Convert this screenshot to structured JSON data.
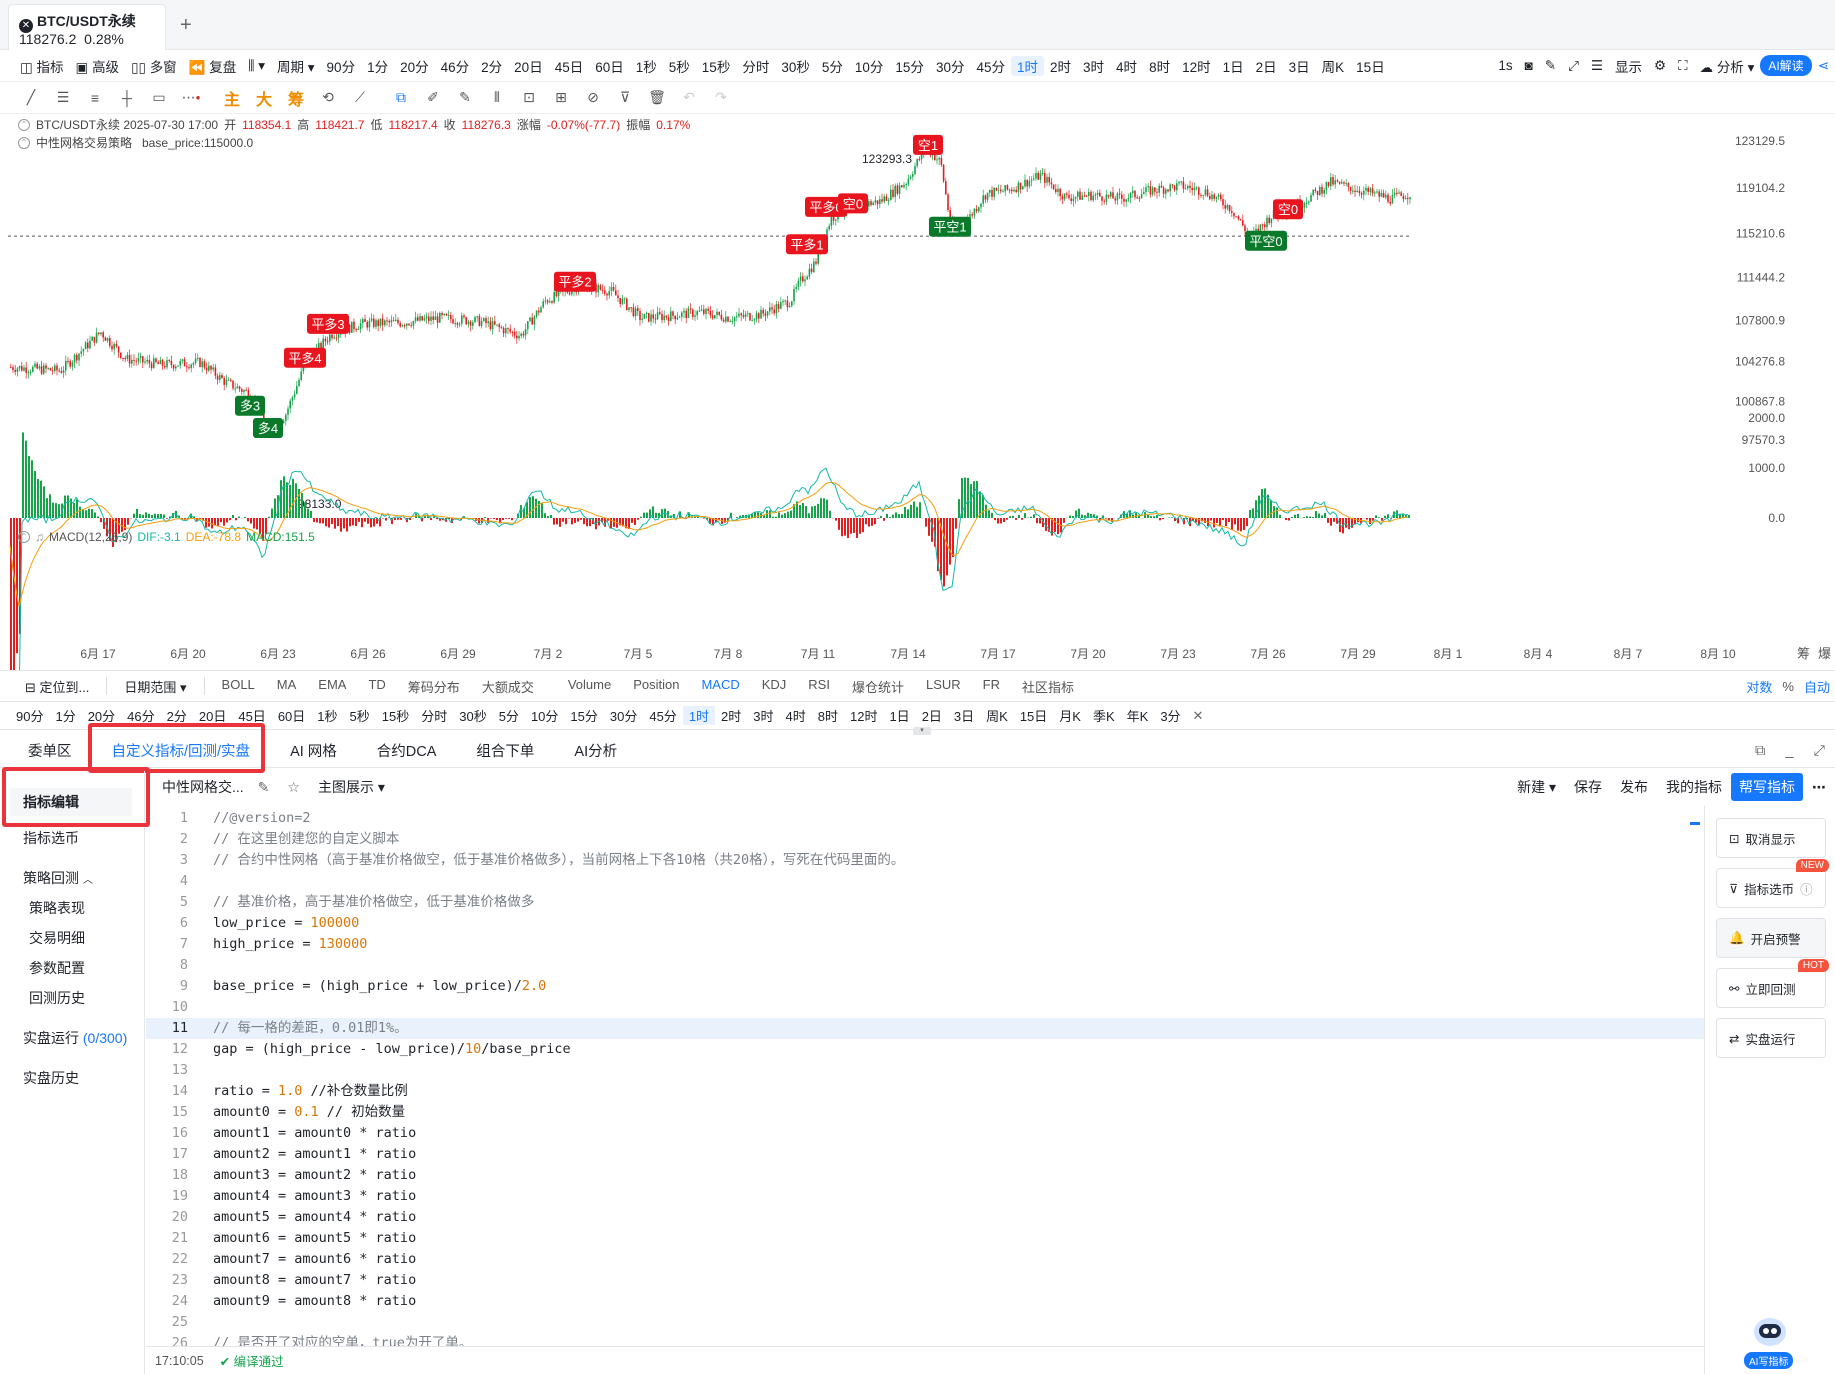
{
  "tab": {
    "symbol": "BTC/USDT永续",
    "price": "118276.2",
    "change": "0.28%",
    "add": "+"
  },
  "toolbar1": {
    "left": [
      "指标",
      "高级",
      "多窗",
      "复盘",
      "周期"
    ],
    "periods": [
      "90分",
      "1分",
      "20分",
      "46分",
      "2分",
      "20日",
      "45日",
      "60日",
      "1秒",
      "5秒",
      "15秒",
      "分时",
      "30秒",
      "5分",
      "10分",
      "15分",
      "30分",
      "45分",
      "1时",
      "2时",
      "3时",
      "4时",
      "8时",
      "12时",
      "1日",
      "2日",
      "3日",
      "周K",
      "15日"
    ],
    "active": "1时",
    "right": [
      "1s",
      "显示",
      "分析",
      "AI解读"
    ]
  },
  "toolbar2": {
    "text_tools": [
      "主",
      "大",
      "筹"
    ]
  },
  "chart_info": {
    "line1_prefix": "BTC/USDT永续  2025-07-30 17:00",
    "open_label": "开",
    "open": "118354.1",
    "high_label": "高",
    "high": "118421.7",
    "low_label": "低",
    "low": "118217.4",
    "close_label": "收",
    "close": "118276.3",
    "chg_label": "涨幅",
    "chg": "-0.07%(-77.7)",
    "amp_label": "振幅",
    "amp": "0.17%",
    "line2": "中性网格交易策略   base_price:115000.0"
  },
  "chart_data": {
    "type": "line",
    "price_axis": [
      "123129.5",
      "119104.2",
      "115210.6",
      "111444.2",
      "107800.9",
      "104276.8",
      "100867.8",
      "97570.3"
    ],
    "high_label": "123293.3",
    "low_label": "98133.0",
    "base_price": 115000.0,
    "x_axis": [
      "6月 17",
      "6月 20",
      "6月 23",
      "6月 26",
      "6月 29",
      "7月 2",
      "7月 5",
      "7月 8",
      "7月 11",
      "7月 14",
      "7月 17",
      "7月 20",
      "7月 23",
      "7月 26",
      "7月 29",
      "8月 1",
      "8月 4",
      "8月 7",
      "8月 10"
    ],
    "signals": [
      {
        "label": "多3",
        "type": "long",
        "price": 100500
      },
      {
        "label": "多4",
        "type": "long",
        "price": 98600
      },
      {
        "label": "平多4",
        "type": "close",
        "price": 104600
      },
      {
        "label": "平多3",
        "type": "close",
        "price": 107500
      },
      {
        "label": "平多2",
        "type": "close",
        "price": 111100
      },
      {
        "label": "平多1",
        "type": "close",
        "price": 114300
      },
      {
        "label": "平多0",
        "type": "close",
        "price": 117500
      },
      {
        "label": "空0",
        "type": "short",
        "price": 117800
      },
      {
        "label": "空1",
        "type": "short",
        "price": 122800
      },
      {
        "label": "平空1",
        "type": "cover",
        "price": 115800
      },
      {
        "label": "空0",
        "type": "short",
        "price": 117300
      },
      {
        "label": "平空0",
        "type": "cover",
        "price": 114600
      }
    ],
    "macd": {
      "label": "MACD(12,26,9)",
      "dif_label": "DIF:-3.1",
      "dea_label": "DEA:-78.8",
      "macd_label": "MACD:151.5",
      "axis": [
        "2000.0",
        "1000.0",
        "0.0"
      ]
    },
    "corner_labels": [
      "筹",
      "爆"
    ]
  },
  "indicator_bar": {
    "locate": "定位到...",
    "date_range": "日期范围",
    "items": [
      "BOLL",
      "MA",
      "EMA",
      "TD",
      "筹码分布",
      "大额成交",
      "Volume",
      "Position",
      "MACD",
      "KDJ",
      "RSI",
      "爆仓统计",
      "LSUR",
      "FR",
      "社区指标"
    ],
    "active": "MACD",
    "right": [
      "对数",
      "%",
      "自动"
    ]
  },
  "period_bar": {
    "items": [
      "90分",
      "1分",
      "20分",
      "46分",
      "2分",
      "20日",
      "45日",
      "60日",
      "1秒",
      "5秒",
      "15秒",
      "分时",
      "30秒",
      "5分",
      "10分",
      "15分",
      "30分",
      "45分",
      "1时",
      "2时",
      "3时",
      "4时",
      "8时",
      "12时",
      "1日",
      "2日",
      "3日",
      "周K",
      "15日",
      "月K",
      "季K",
      "年K",
      "3分"
    ],
    "active": "1时",
    "close": "✕"
  },
  "bottom_tabs": {
    "items": [
      "委单区",
      "自定义指标/回测/实盘",
      "AI 网格",
      "合约DCA",
      "组合下单",
      "AI分析"
    ],
    "active": "自定义指标/回测/实盘"
  },
  "left_nav": {
    "edit": "指标编辑",
    "pick": "指标选币",
    "backtest": "策略回测",
    "sub": [
      "策略表现",
      "交易明细",
      "参数配置",
      "回测历史"
    ],
    "live": "实盘运行",
    "live_count": "(0/300)",
    "history": "实盘历史"
  },
  "editor": {
    "name": "中性网格交...",
    "show": "主图展示",
    "actions": [
      "新建",
      "保存",
      "发布",
      "我的指标"
    ],
    "primary": "帮写指标"
  },
  "code": [
    "//@version=2",
    "// 在这里创建您的自定义脚本",
    "// 合约中性网格（高于基准价格做空，低于基准价格做多），当前网格上下各10格（共20格），写死在代码里面的。",
    "",
    "// 基准价格，高于基准价格做空，低于基准价格做多",
    "low_price = 100000",
    "high_price = 130000",
    "",
    "base_price = (high_price + low_price)/2.0",
    "",
    "// 每一格的差距，0.01即1%。",
    "gap = (high_price - low_price)/10/base_price",
    "",
    "ratio = 1.0 //补仓数量比例",
    "amount0 = 0.1 // 初始数量",
    "amount1 = amount0 * ratio",
    "amount2 = amount1 * ratio",
    "amount3 = amount2 * ratio",
    "amount4 = amount3 * ratio",
    "amount5 = amount4 * ratio",
    "amount6 = amount5 * ratio",
    "amount7 = amount6 * ratio",
    "amount8 = amount7 * ratio",
    "amount9 = amount8 * ratio",
    "",
    "// 是否开了对应的空单，true为开了单。"
  ],
  "right_panel": {
    "buttons": [
      "取消显示",
      "指标选币",
      "开启预警",
      "立即回测",
      "实盘运行"
    ],
    "badges": [
      "NEW",
      "HOT"
    ],
    "ai_write": "AI写指标"
  },
  "status": {
    "time": "17:10:05",
    "msg": "编译通过"
  }
}
